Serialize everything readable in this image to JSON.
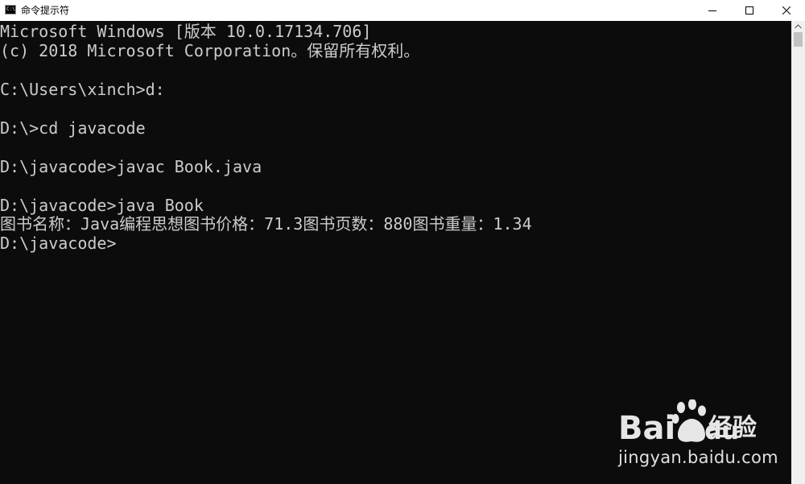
{
  "window": {
    "title": "命令提示符",
    "icon": "cmd-app-icon",
    "icon_text": "C:\\",
    "controls": {
      "minimize": "minimize-icon",
      "maximize": "maximize-icon",
      "close": "close-icon"
    }
  },
  "console": {
    "background": "#0c0c0c",
    "foreground": "#cccccc",
    "lines": [
      "Microsoft Windows [版本 10.0.17134.706]",
      "(c) 2018 Microsoft Corporation。保留所有权利。",
      "",
      "C:\\Users\\xinch>d:",
      "",
      "D:\\>cd javacode",
      "",
      "D:\\javacode>javac Book.java",
      "",
      "D:\\javacode>java Book",
      "图书名称：Java编程思想图书价格：71.3图书页数：880图书重量：1.34",
      "D:\\javacode>"
    ]
  },
  "watermark": {
    "logo_text": "Bai",
    "logo_suffix": "du",
    "brand_cn": "经验",
    "url": "jingyan.baidu.com"
  }
}
